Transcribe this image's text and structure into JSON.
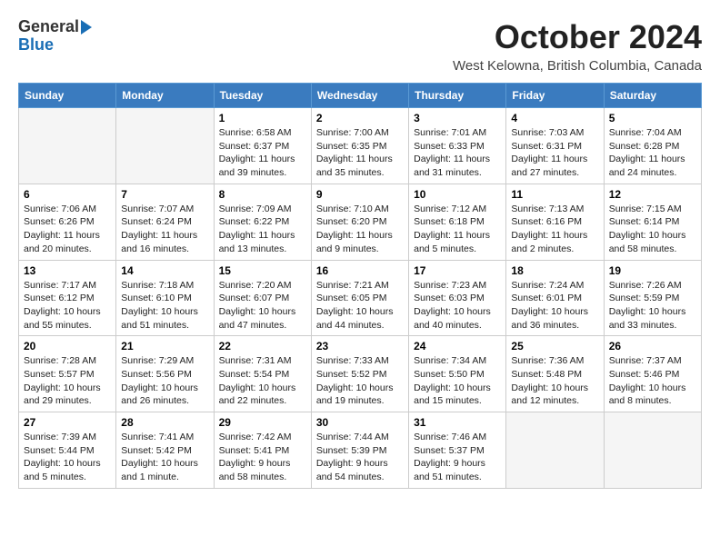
{
  "header": {
    "logo_general": "General",
    "logo_blue": "Blue",
    "month": "October 2024",
    "location": "West Kelowna, British Columbia, Canada"
  },
  "weekdays": [
    "Sunday",
    "Monday",
    "Tuesday",
    "Wednesday",
    "Thursday",
    "Friday",
    "Saturday"
  ],
  "weeks": [
    [
      {
        "day": "",
        "text": ""
      },
      {
        "day": "",
        "text": ""
      },
      {
        "day": "1",
        "text": "Sunrise: 6:58 AM\nSunset: 6:37 PM\nDaylight: 11 hours and 39 minutes."
      },
      {
        "day": "2",
        "text": "Sunrise: 7:00 AM\nSunset: 6:35 PM\nDaylight: 11 hours and 35 minutes."
      },
      {
        "day": "3",
        "text": "Sunrise: 7:01 AM\nSunset: 6:33 PM\nDaylight: 11 hours and 31 minutes."
      },
      {
        "day": "4",
        "text": "Sunrise: 7:03 AM\nSunset: 6:31 PM\nDaylight: 11 hours and 27 minutes."
      },
      {
        "day": "5",
        "text": "Sunrise: 7:04 AM\nSunset: 6:28 PM\nDaylight: 11 hours and 24 minutes."
      }
    ],
    [
      {
        "day": "6",
        "text": "Sunrise: 7:06 AM\nSunset: 6:26 PM\nDaylight: 11 hours and 20 minutes."
      },
      {
        "day": "7",
        "text": "Sunrise: 7:07 AM\nSunset: 6:24 PM\nDaylight: 11 hours and 16 minutes."
      },
      {
        "day": "8",
        "text": "Sunrise: 7:09 AM\nSunset: 6:22 PM\nDaylight: 11 hours and 13 minutes."
      },
      {
        "day": "9",
        "text": "Sunrise: 7:10 AM\nSunset: 6:20 PM\nDaylight: 11 hours and 9 minutes."
      },
      {
        "day": "10",
        "text": "Sunrise: 7:12 AM\nSunset: 6:18 PM\nDaylight: 11 hours and 5 minutes."
      },
      {
        "day": "11",
        "text": "Sunrise: 7:13 AM\nSunset: 6:16 PM\nDaylight: 11 hours and 2 minutes."
      },
      {
        "day": "12",
        "text": "Sunrise: 7:15 AM\nSunset: 6:14 PM\nDaylight: 10 hours and 58 minutes."
      }
    ],
    [
      {
        "day": "13",
        "text": "Sunrise: 7:17 AM\nSunset: 6:12 PM\nDaylight: 10 hours and 55 minutes."
      },
      {
        "day": "14",
        "text": "Sunrise: 7:18 AM\nSunset: 6:10 PM\nDaylight: 10 hours and 51 minutes."
      },
      {
        "day": "15",
        "text": "Sunrise: 7:20 AM\nSunset: 6:07 PM\nDaylight: 10 hours and 47 minutes."
      },
      {
        "day": "16",
        "text": "Sunrise: 7:21 AM\nSunset: 6:05 PM\nDaylight: 10 hours and 44 minutes."
      },
      {
        "day": "17",
        "text": "Sunrise: 7:23 AM\nSunset: 6:03 PM\nDaylight: 10 hours and 40 minutes."
      },
      {
        "day": "18",
        "text": "Sunrise: 7:24 AM\nSunset: 6:01 PM\nDaylight: 10 hours and 36 minutes."
      },
      {
        "day": "19",
        "text": "Sunrise: 7:26 AM\nSunset: 5:59 PM\nDaylight: 10 hours and 33 minutes."
      }
    ],
    [
      {
        "day": "20",
        "text": "Sunrise: 7:28 AM\nSunset: 5:57 PM\nDaylight: 10 hours and 29 minutes."
      },
      {
        "day": "21",
        "text": "Sunrise: 7:29 AM\nSunset: 5:56 PM\nDaylight: 10 hours and 26 minutes."
      },
      {
        "day": "22",
        "text": "Sunrise: 7:31 AM\nSunset: 5:54 PM\nDaylight: 10 hours and 22 minutes."
      },
      {
        "day": "23",
        "text": "Sunrise: 7:33 AM\nSunset: 5:52 PM\nDaylight: 10 hours and 19 minutes."
      },
      {
        "day": "24",
        "text": "Sunrise: 7:34 AM\nSunset: 5:50 PM\nDaylight: 10 hours and 15 minutes."
      },
      {
        "day": "25",
        "text": "Sunrise: 7:36 AM\nSunset: 5:48 PM\nDaylight: 10 hours and 12 minutes."
      },
      {
        "day": "26",
        "text": "Sunrise: 7:37 AM\nSunset: 5:46 PM\nDaylight: 10 hours and 8 minutes."
      }
    ],
    [
      {
        "day": "27",
        "text": "Sunrise: 7:39 AM\nSunset: 5:44 PM\nDaylight: 10 hours and 5 minutes."
      },
      {
        "day": "28",
        "text": "Sunrise: 7:41 AM\nSunset: 5:42 PM\nDaylight: 10 hours and 1 minute."
      },
      {
        "day": "29",
        "text": "Sunrise: 7:42 AM\nSunset: 5:41 PM\nDaylight: 9 hours and 58 minutes."
      },
      {
        "day": "30",
        "text": "Sunrise: 7:44 AM\nSunset: 5:39 PM\nDaylight: 9 hours and 54 minutes."
      },
      {
        "day": "31",
        "text": "Sunrise: 7:46 AM\nSunset: 5:37 PM\nDaylight: 9 hours and 51 minutes."
      },
      {
        "day": "",
        "text": ""
      },
      {
        "day": "",
        "text": ""
      }
    ]
  ]
}
